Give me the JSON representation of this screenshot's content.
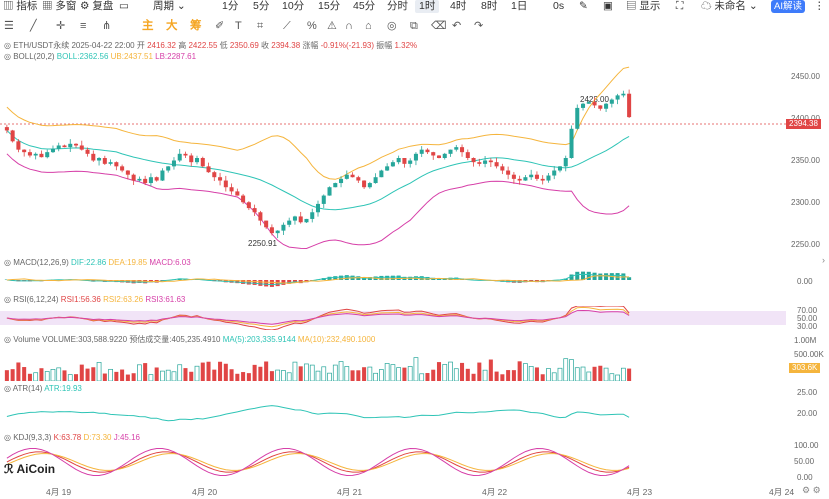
{
  "toolbar": {
    "indicators": "指标",
    "multi_window": "多窗",
    "replay": "复盘",
    "period": "周期",
    "timeframes": [
      "1分",
      "5分",
      "10分",
      "15分",
      "45分",
      "分时",
      "1时",
      "4时",
      "8时",
      "1日"
    ],
    "active_timeframe": "1时",
    "zero_s": "0s",
    "display": "显示",
    "unnamed": "未命名",
    "ai_button": "AI解读"
  },
  "drawing_toolbar": {
    "main_label": "主",
    "big_label": "大",
    "chips_label": "筹"
  },
  "main_panel": {
    "symbol_info": "ETH/USDT永续",
    "datetime": "2025-04-22 22:00",
    "open_label": "开",
    "open": "2416.32",
    "high_label": "高",
    "high": "2422.55",
    "low_label": "低",
    "low": "2350.69",
    "close_label": "收",
    "close": "2394.38",
    "change_label": "涨幅",
    "change": "-0.91%(-21.93)",
    "amplitude_label": "振幅",
    "amplitude": "1.32%",
    "boll_label": "BOLL(20,2)",
    "boll": "BOLL:2362.56",
    "ub": "UB:2437.51",
    "lb": "LB:2287.61",
    "high_marker": "2423.00",
    "low_marker": "2250.91",
    "current_price": "2394.38",
    "y_ticks": [
      "2450.00",
      "2400.00",
      "2350.00",
      "2300.00",
      "2250.00"
    ]
  },
  "macd_panel": {
    "label": "MACD(12,26,9)",
    "dif": "DIF:22.86",
    "dea": "DEA:19.85",
    "macd": "MACD:6.03",
    "y_ticks": [
      "0.00"
    ]
  },
  "rsi_panel": {
    "label": "RSI(6,12,24)",
    "rsi1": "RSI1:56.36",
    "rsi2": "RSI2:63.26",
    "rsi3": "RSI3:61.63",
    "y_ticks": [
      "70.00",
      "50.00",
      "30.00"
    ]
  },
  "volume_panel": {
    "label": "Volume",
    "volume": "VOLUME:303,588.9220",
    "forecast": "预估成交量:405,235.4910",
    "ma5": "MA(5):203,335.9144",
    "ma10": "MA(10):232,490.1000",
    "y_ticks": [
      "1.00M",
      "500.00K"
    ],
    "current_tag": "303.6K"
  },
  "atr_panel": {
    "label": "ATR(14)",
    "atr": "ATR:19.93",
    "y_ticks": [
      "25.00",
      "20.00"
    ]
  },
  "kdj_panel": {
    "label": "KDJ(9,3,3)",
    "k": "K:63.78",
    "d": "D:73.30",
    "j": "J:45.16",
    "y_ticks": [
      "100.00",
      "50.00",
      "0.00"
    ]
  },
  "x_axis": {
    "labels": [
      "4月 19",
      "4月 20",
      "4月 21",
      "4月 22",
      "4月 23",
      "4月 24"
    ]
  },
  "brand": {
    "logo_text": "AiCoin"
  },
  "colors": {
    "up": "#26a69a",
    "down": "#e04545",
    "boll_mid": "#2ec4b6",
    "boll_ub": "#f5b53d",
    "boll_lb": "#d63fa8",
    "accent": "#3e7bfa"
  },
  "chart_data": {
    "type": "candlestick",
    "symbol": "ETH/USDT永续",
    "interval": "1时",
    "ylim": [
      2230,
      2460
    ],
    "series_close": [
      2378,
      2365,
      2355,
      2352,
      2348,
      2350,
      2346,
      2352,
      2356,
      2360,
      2358,
      2362,
      2360,
      2355,
      2350,
      2342,
      2345,
      2338,
      2340,
      2335,
      2330,
      2325,
      2318,
      2320,
      2315,
      2322,
      2318,
      2330,
      2335,
      2342,
      2350,
      2348,
      2340,
      2345,
      2335,
      2328,
      2322,
      2318,
      2310,
      2305,
      2300,
      2292,
      2285,
      2280,
      2270,
      2262,
      2255,
      2258,
      2265,
      2270,
      2275,
      2268,
      2272,
      2280,
      2290,
      2300,
      2310,
      2315,
      2320,
      2325,
      2322,
      2318,
      2310,
      2315,
      2322,
      2330,
      2335,
      2340,
      2345,
      2338,
      2342,
      2350,
      2355,
      2352,
      2348,
      2345,
      2350,
      2355,
      2358,
      2352,
      2345,
      2340,
      2338,
      2342,
      2340,
      2335,
      2330,
      2325,
      2320,
      2318,
      2322,
      2325,
      2320,
      2318,
      2324,
      2330,
      2335,
      2345,
      2380,
      2405,
      2410,
      2412,
      2408,
      2404,
      2410,
      2415,
      2420,
      2422,
      2394
    ],
    "high": 2423.0,
    "low": 2250.91,
    "last": 2394.38
  }
}
